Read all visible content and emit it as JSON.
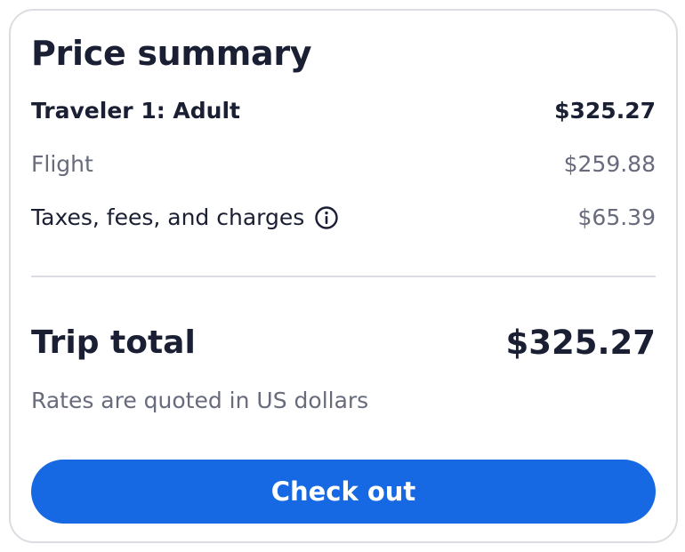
{
  "summary": {
    "title": "Price summary",
    "traveler": {
      "label": "Traveler 1: Adult",
      "amount": "$325.27"
    },
    "flight": {
      "label": "Flight",
      "amount": "$259.88"
    },
    "taxes": {
      "label": "Taxes, fees, and charges",
      "amount": "$65.39",
      "icon": "info-icon"
    },
    "total": {
      "label": "Trip total",
      "amount": "$325.27"
    },
    "note": "Rates are quoted in US dollars",
    "checkout_label": "Check out"
  },
  "colors": {
    "accent": "#1668e3",
    "text_primary": "#1a1f33",
    "text_secondary": "#676b7c",
    "border": "#dcdde2"
  }
}
